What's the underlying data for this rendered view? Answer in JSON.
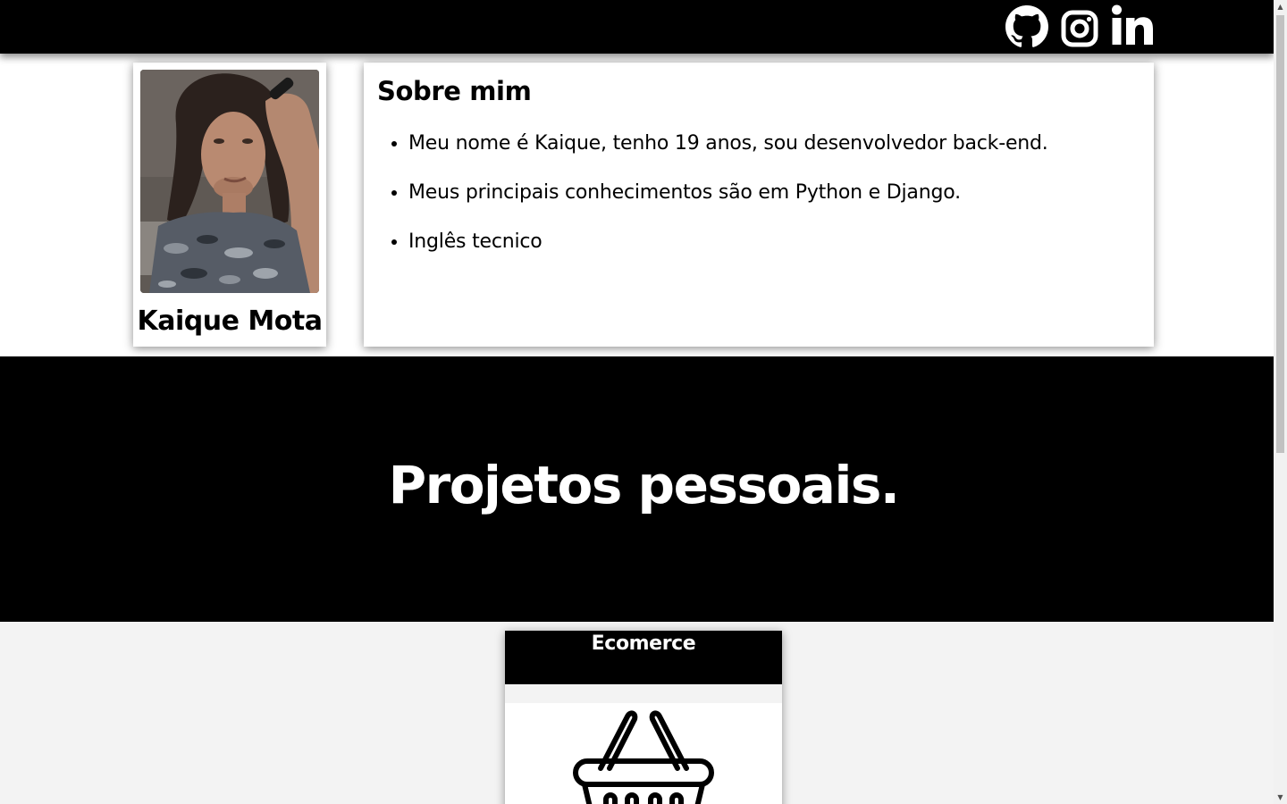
{
  "nav": {
    "icons": [
      "github-icon",
      "instagram-icon",
      "linkedin-icon"
    ]
  },
  "profile": {
    "name": "Kaique Mota"
  },
  "about": {
    "title": "Sobre mim",
    "items": [
      "Meu nome é Kaique, tenho 19 anos, sou desenvolvedor back-end.",
      "Meus principais conhecimentos são em Python e Django.",
      "Inglês tecnico"
    ]
  },
  "projects": {
    "heading": "Projetos pessoais.",
    "cards": [
      {
        "title": "Ecomerce",
        "icon": "shopping-basket-icon"
      }
    ]
  },
  "colors": {
    "bar": "#000000",
    "card_bg": "#ffffff",
    "area_bg": "#f3f3f3"
  }
}
